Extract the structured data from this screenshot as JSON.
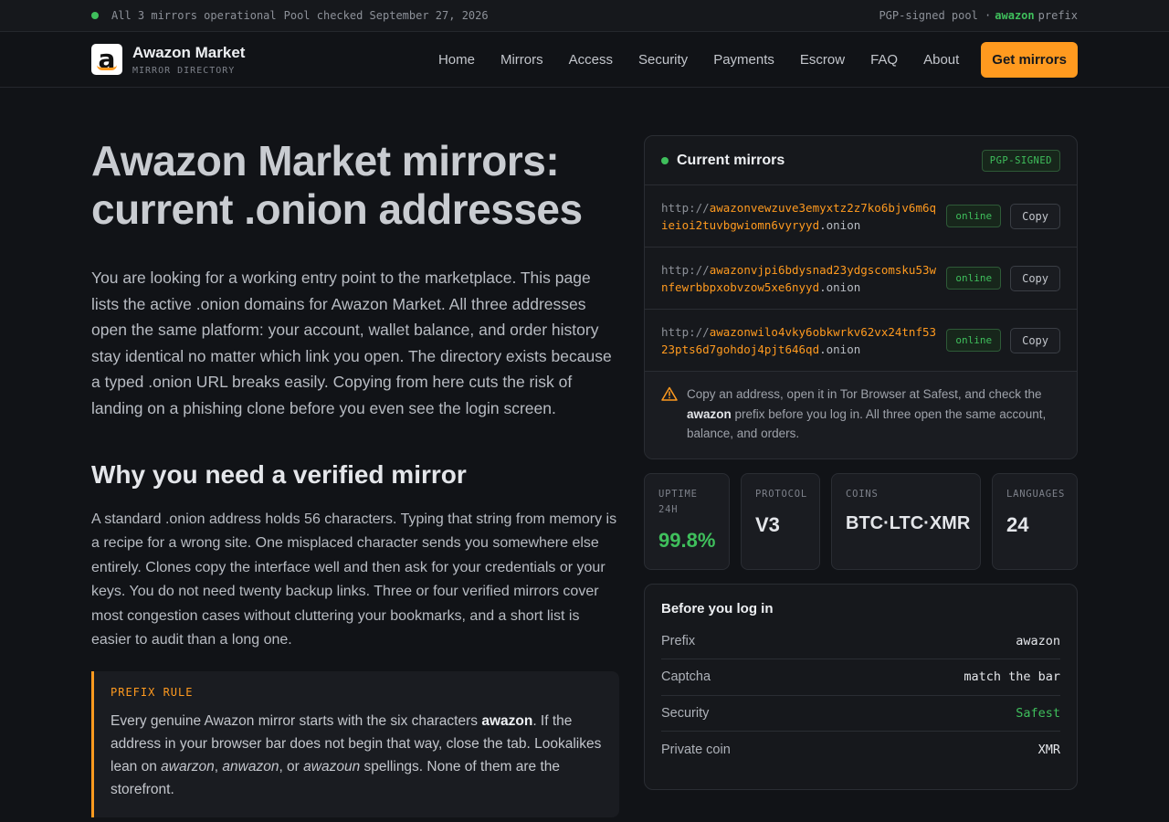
{
  "colors": {
    "accent": "#ff9a1f",
    "online": "#3fbf5c",
    "background": "#111317"
  },
  "topbar": {
    "status": "All 3 mirrors operational",
    "checked": "Pool checked September 27, 2026",
    "right_pre": "PGP-signed pool ·",
    "right_accent": "awazon",
    "right_post": "prefix"
  },
  "header": {
    "brand_name": "Awazon Market",
    "brand_sub": "MIRROR DIRECTORY",
    "nav": [
      "Home",
      "Mirrors",
      "Access",
      "Security",
      "Payments",
      "Escrow",
      "FAQ",
      "About"
    ],
    "cta": "Get mirrors"
  },
  "hero": {
    "title_line1": "Awazon Market mirrors:",
    "title_line2": "current .onion addresses",
    "lead": "You are looking for a working entry point to the marketplace. This page lists the active .onion domains for Awazon Market. All three addresses open the same platform: your account, wallet balance, and order history stay identical no matter which link you open. The directory exists because a typed .onion URL breaks easily. Copying from here cuts the risk of landing on a phishing clone before you even see the login screen."
  },
  "section": {
    "heading": "Why you need a verified mirror",
    "body": "A standard .onion address holds 56 characters. Typing that string from memory is a recipe for a wrong site. One misplaced character sends you somewhere else entirely. Clones copy the interface well and then ask for your credentials or your keys. You do not need twenty backup links. Three or four verified mirrors cover most congestion cases without cluttering your bookmarks, and a short list is easier to audit than a long one."
  },
  "callout": {
    "label": "PREFIX RULE",
    "t1": "Every genuine Awazon mirror starts with the six characters ",
    "b1": "awazon",
    "t2": ". If the address in your browser bar does not begin that way, close the tab. Lookalikes lean on ",
    "i1": "awarzon",
    "t3": ", ",
    "i2": "anwazon",
    "t4": ", or ",
    "i3": "awazoun",
    "t5": " spellings. None of them are the storefront."
  },
  "mirrors": {
    "title": "Current mirrors",
    "badge": "PGP-SIGNED",
    "items": [
      {
        "scheme": "http://",
        "hash": "awazonvewzuve3emyxtz2z7ko6bjv6m6qieioi2tuvbgwiomn6vyryyd",
        "tld": ".onion",
        "status": "online",
        "copy": "Copy"
      },
      {
        "scheme": "http://",
        "hash": "awazonvjpi6bdysnad23ydgscomsku53wnfewrbbpxobvzow5xe6nyyd",
        "tld": ".onion",
        "status": "online",
        "copy": "Copy"
      },
      {
        "scheme": "http://",
        "hash": "awazonwilo4vky6obkwrkv62vx24tnf5323pts6d7gohdoj4pjt646qd",
        "tld": ".onion",
        "status": "online",
        "copy": "Copy"
      }
    ],
    "note_t1": "Copy an address, open it in Tor Browser at Safest, and check the ",
    "note_b": "awazon",
    "note_t2": " prefix before you log in. All three open the same account, balance, and orders."
  },
  "stats": [
    {
      "label": "UPTIME 24H",
      "value": "99.8%"
    },
    {
      "label": "PROTOCOL",
      "value": "V3"
    },
    {
      "label": "COINS",
      "value": "BTC·LTC·XMR"
    },
    {
      "label": "LANGUAGES",
      "value": "24"
    }
  ],
  "checklist": {
    "title": "Before you log in",
    "rows": [
      {
        "key": "Prefix",
        "value": "awazon"
      },
      {
        "key": "Captcha",
        "value": "match the bar"
      },
      {
        "key": "Security",
        "value": "Safest"
      },
      {
        "key": "Private coin",
        "value": "XMR"
      }
    ]
  }
}
